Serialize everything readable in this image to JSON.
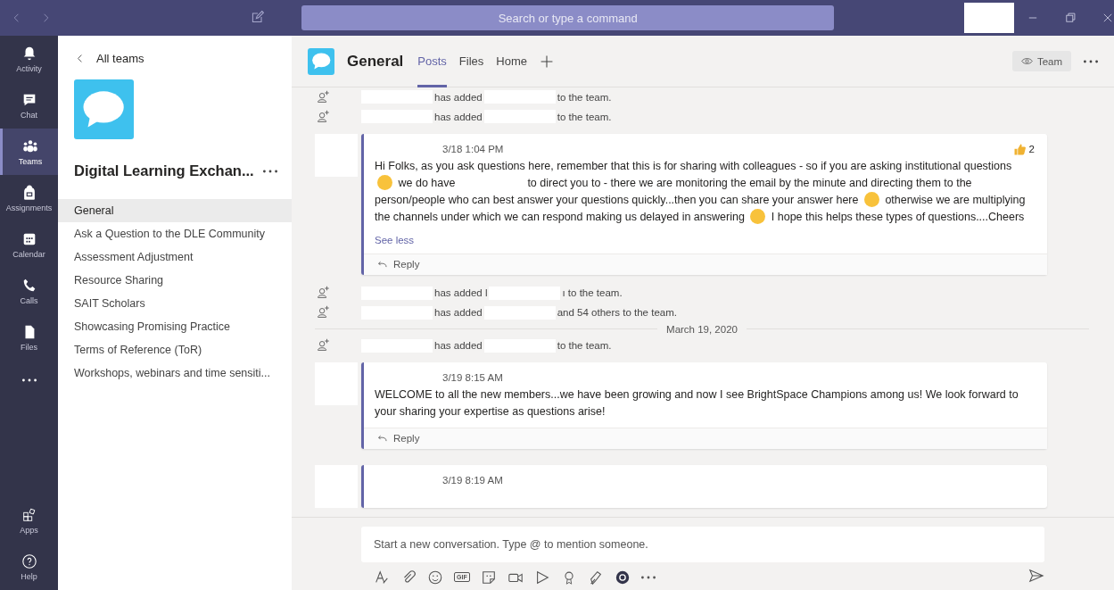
{
  "title_bar": {
    "search_placeholder": "Search or type a command"
  },
  "rail": [
    {
      "label": "Activity",
      "selected": false
    },
    {
      "label": "Chat",
      "selected": false
    },
    {
      "label": "Teams",
      "selected": true
    },
    {
      "label": "Assignments",
      "selected": false
    },
    {
      "label": "Calendar",
      "selected": false
    },
    {
      "label": "Calls",
      "selected": false
    },
    {
      "label": "Files",
      "selected": false
    }
  ],
  "rail_bottom": [
    {
      "label": "Apps"
    },
    {
      "label": "Help"
    }
  ],
  "team_panel": {
    "back_label": "All teams",
    "team_name": "Digital Learning Exchan...",
    "channels": [
      {
        "label": "General",
        "selected": true
      },
      {
        "label": "Ask a Question to the DLE Community",
        "selected": false
      },
      {
        "label": "Assessment Adjustment",
        "selected": false
      },
      {
        "label": "Resource Sharing",
        "selected": false
      },
      {
        "label": "SAIT Scholars",
        "selected": false
      },
      {
        "label": "Showcasing Promising Practice",
        "selected": false
      },
      {
        "label": "Terms of Reference (ToR)",
        "selected": false
      },
      {
        "label": "Workshops, webinars and time sensiti...",
        "selected": false
      }
    ]
  },
  "channel_header": {
    "title": "General",
    "tabs": [
      {
        "label": "Posts",
        "selected": true
      },
      {
        "label": "Files",
        "selected": false
      },
      {
        "label": "Home",
        "selected": false
      }
    ],
    "team_button": "Team"
  },
  "feed": [
    {
      "kind": "activity",
      "parts": [
        {
          "kind": "redacted"
        },
        {
          "kind": "text",
          "text": "has added"
        },
        {
          "kind": "redacted"
        },
        {
          "kind": "text",
          "text": "to the team."
        }
      ]
    },
    {
      "kind": "activity",
      "parts": [
        {
          "kind": "redacted"
        },
        {
          "kind": "text",
          "text": "has added"
        },
        {
          "kind": "redacted"
        },
        {
          "kind": "text",
          "text": "to the team."
        }
      ]
    },
    {
      "kind": "post",
      "time": "3/18 1:04 PM",
      "likes": "2",
      "see_less": "See less",
      "reply": "Reply",
      "parts": [
        {
          "kind": "text",
          "text": "Hi Folks, as you ask questions here, remember that this is for sharing with colleagues - so if you are asking institutional questions"
        },
        {
          "kind": "emoji"
        },
        {
          "kind": "text",
          "text": "we do have"
        },
        {
          "kind": "redacted"
        },
        {
          "kind": "text",
          "text": "to direct you to - there we are monitoring the email by the minute and directing them to the person/people who can best answer your questions quickly...then you can share your answer here"
        },
        {
          "kind": "emoji"
        },
        {
          "kind": "text",
          "text": "otherwise we are multiplying the channels under which we can respond making us delayed in answering"
        },
        {
          "kind": "emoji"
        },
        {
          "kind": "text",
          "text": "I hope this helps these types of questions....Cheers"
        }
      ]
    },
    {
      "kind": "activity",
      "parts": [
        {
          "kind": "redacted"
        },
        {
          "kind": "text",
          "text": "has added l"
        },
        {
          "kind": "redacted"
        },
        {
          "kind": "text",
          "text": "ı to the team."
        }
      ]
    },
    {
      "kind": "activity",
      "parts": [
        {
          "kind": "redacted"
        },
        {
          "kind": "text",
          "text": "has added"
        },
        {
          "kind": "redacted"
        },
        {
          "kind": "text",
          "text": "and 54 others to the team."
        }
      ]
    },
    {
      "kind": "date",
      "text": "March 19, 2020"
    },
    {
      "kind": "activity",
      "parts": [
        {
          "kind": "redacted"
        },
        {
          "kind": "text",
          "text": "has added"
        },
        {
          "kind": "redacted"
        },
        {
          "kind": "text",
          "text": "to the team."
        }
      ]
    },
    {
      "kind": "post",
      "time": "3/19 8:15 AM",
      "reply": "Reply",
      "parts": [
        {
          "kind": "text",
          "text": "WELCOME to all the new members...we have been growing and now I see BrightSpace Champions among us!  We look forward to your sharing your expertise as questions arise!"
        }
      ]
    },
    {
      "kind": "post",
      "time": "3/19 8:19 AM"
    }
  ],
  "composer": {
    "placeholder": "Start a new conversation. Type @ to mention someone.",
    "tools": [
      {
        "kind": "format"
      },
      {
        "kind": "attach"
      },
      {
        "kind": "emoji"
      },
      {
        "kind": "gif",
        "label": "GIF"
      },
      {
        "kind": "sticker"
      },
      {
        "kind": "meet"
      },
      {
        "kind": "stream"
      },
      {
        "kind": "praise"
      },
      {
        "kind": "ink"
      },
      {
        "kind": "app"
      },
      {
        "kind": "more"
      }
    ]
  }
}
